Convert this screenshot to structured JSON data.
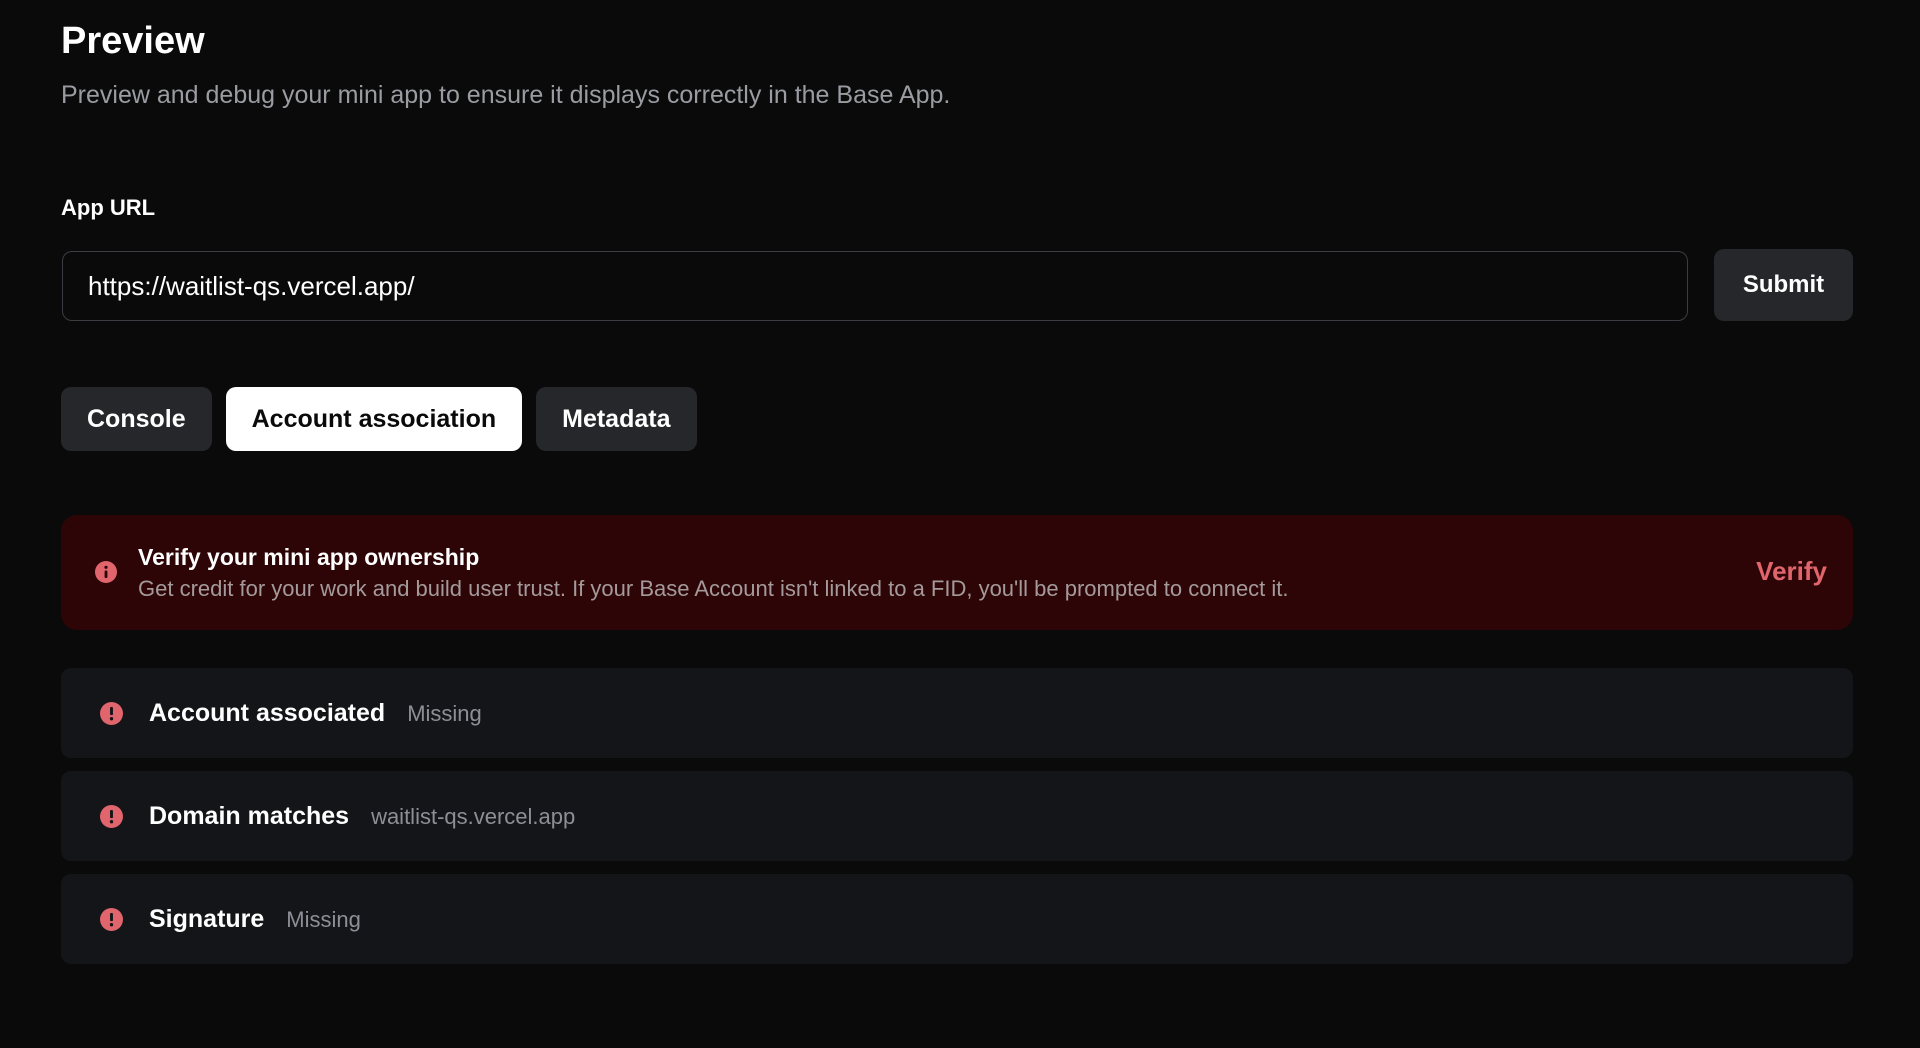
{
  "header": {
    "title": "Preview",
    "subtitle": "Preview and debug your mini app to ensure it displays correctly in the Base App."
  },
  "url_form": {
    "label": "App URL",
    "value": "https://waitlist-qs.vercel.app/",
    "submit_label": "Submit"
  },
  "tabs": [
    {
      "label": "Console",
      "active": false
    },
    {
      "label": "Account association",
      "active": true
    },
    {
      "label": "Metadata",
      "active": false
    }
  ],
  "alert": {
    "icon": "info-icon",
    "title": "Verify your mini app ownership",
    "description": "Get credit for your work and build user trust. If your Base Account isn't linked to a FID, you'll be prompted to connect it.",
    "action_label": "Verify",
    "background_color": "#2d0506",
    "accent_color": "#e0656c"
  },
  "checks": [
    {
      "icon": "error-icon",
      "label": "Account associated",
      "value": "Missing"
    },
    {
      "icon": "error-icon",
      "label": "Domain matches",
      "value": "waitlist-qs.vercel.app"
    },
    {
      "icon": "error-icon",
      "label": "Signature",
      "value": "Missing"
    }
  ],
  "colors": {
    "background": "#0a0a0b",
    "error": "#e0656c",
    "surface": "#141518",
    "tab_inactive": "#26272b"
  }
}
